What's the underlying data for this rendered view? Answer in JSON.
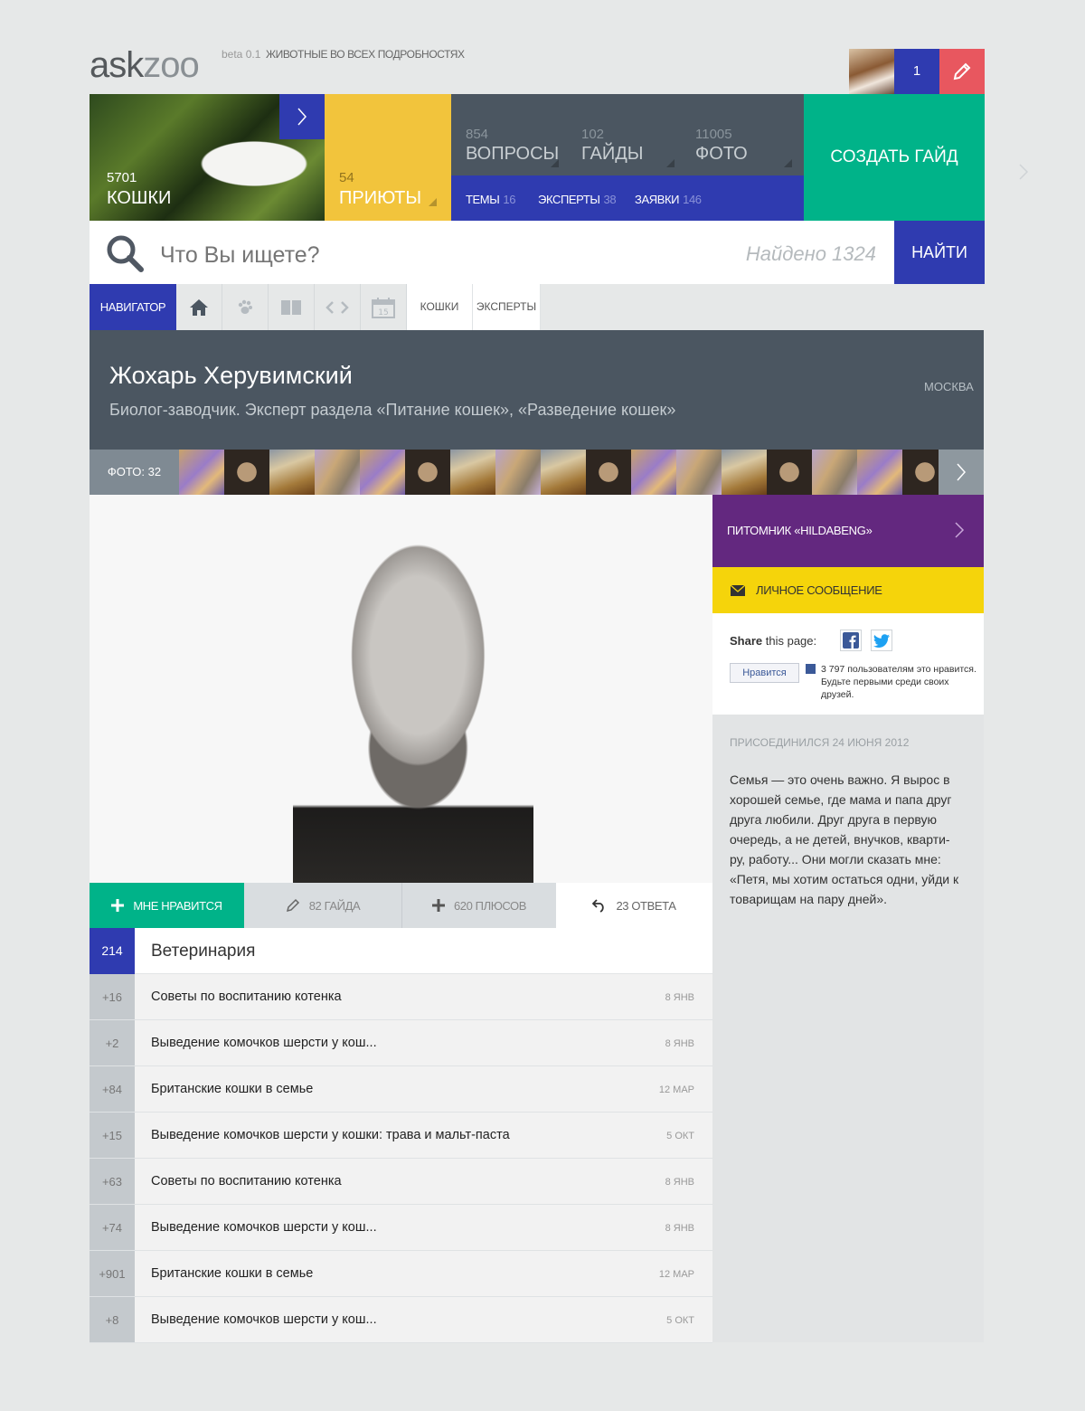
{
  "header": {
    "logo_ask": "ask",
    "logo_zoo": "zoo",
    "beta": "beta 0.1",
    "tagline": "ЖИВОТНЫЕ ВО ВСЕХ ПОДРОБНОСТЯХ",
    "user_count": "1"
  },
  "tiles": {
    "cats": {
      "count": "5701",
      "label": "КОШКИ"
    },
    "shelters": {
      "count": "54",
      "label": "ПРИЮТЫ"
    },
    "stats": [
      {
        "count": "854",
        "label": "ВОПРОСЫ"
      },
      {
        "count": "102",
        "label": "ГАЙДЫ"
      },
      {
        "count": "11005",
        "label": "ФОТО"
      }
    ],
    "sub": [
      {
        "label": "ТЕМЫ",
        "count": "16"
      },
      {
        "label": "ЭКСПЕРТЫ",
        "count": "38"
      },
      {
        "label": "ЗАЯВКИ",
        "count": "146"
      }
    ],
    "create": "СОЗДАТЬ ГАЙД"
  },
  "search": {
    "placeholder": "Что Вы ищете?",
    "found": "Найдено 1324",
    "button": "НАЙТИ"
  },
  "nav": {
    "label": "НАВИГАТОР",
    "links": [
      "КОШКИ",
      "ЭКСПЕРТЫ"
    ],
    "calendar_day": "15"
  },
  "profile": {
    "name": "Жохарь Херувимский",
    "description": "Биолог-заводчик. Эксперт раздела «Питание кошек», «Разведение кошек»",
    "city": "МОСКВА",
    "photos_label": "ФОТО: 32"
  },
  "actions": {
    "like": "МНЕ НРАВИТСЯ",
    "guides": "82 ГАЙДА",
    "pluses": "620 ПЛЮСОВ",
    "answers": "23 ОТВЕТА"
  },
  "category": {
    "count": "214",
    "title": "Ветеринария"
  },
  "questions": [
    {
      "score": "+16",
      "title": "Советы по воспитанию котенка",
      "date": "8 ЯНВ"
    },
    {
      "score": "+2",
      "title": "Выведение комочков шерсти у кош...",
      "date": "8 ЯНВ"
    },
    {
      "score": "+84",
      "title": "Британские кошки в семье",
      "date": "12 МАР"
    },
    {
      "score": "+15",
      "title": "Выведение комочков шерсти у кошки: трава и мальт-паста",
      "date": "5 ОКТ"
    },
    {
      "score": "+63",
      "title": "Советы по воспитанию котенка",
      "date": "8 ЯНВ"
    },
    {
      "score": "+74",
      "title": "Выведение комочков шерсти у кош...",
      "date": "8 ЯНВ"
    },
    {
      "score": "+901",
      "title": "Британские кошки в семье",
      "date": "12 МАР"
    },
    {
      "score": "+8",
      "title": "Выведение комочков шерсти у кош...",
      "date": "5 ОКТ"
    }
  ],
  "sidebar": {
    "kennel": "ПИТОМНИК «HILDABENG»",
    "message": "ЛИЧНОЕ СООБЩЕНИЕ",
    "share_bold": "Share",
    "share_rest": " this page:",
    "fb_like": "Нравится",
    "fb_like_text": "3 797 пользователям это нравится. Будьте первыми среди своих друзей.",
    "joined": "ПРИСОЕДИНИЛСЯ 24 ИЮНЯ 2012",
    "bio": "Семья — это очень важно. Я вырос в хорошей семье, где мама и папа друг друга любили. Друг друга в первую очередь, а не детей, внучков, кварти-ру, работу... Они могли сказать мне: «Петя, мы хотим остаться одни, уйди к товарищам на пару дней»."
  },
  "colors": {
    "blue": "#2f3bb0",
    "yellow": "#f2c43c",
    "green": "#00b389",
    "slate": "#4b5661",
    "purple": "#63287f",
    "red": "#e8575f"
  }
}
